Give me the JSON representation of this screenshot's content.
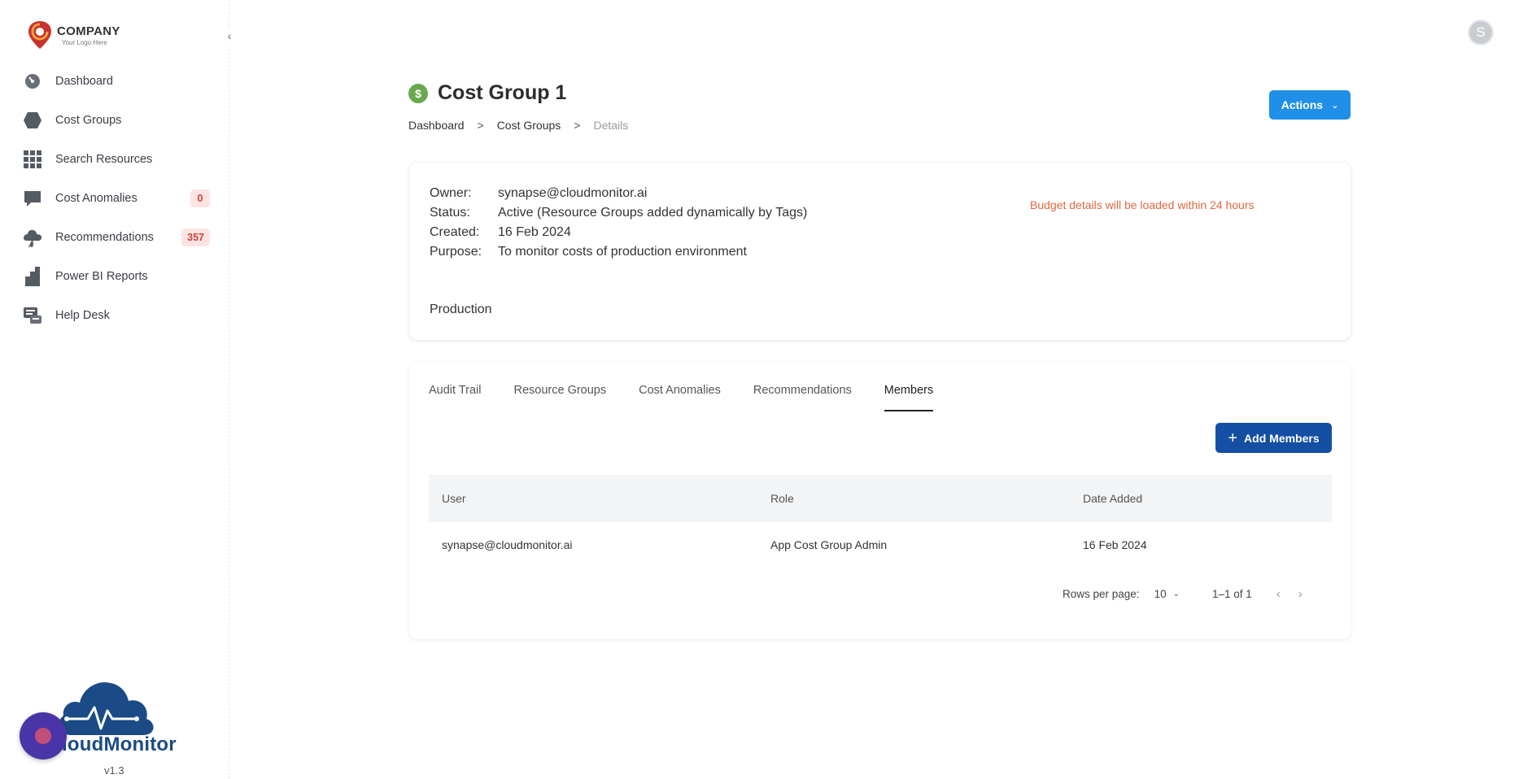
{
  "brand": {
    "company": "COMPANY",
    "tagline": "Your Logo Here",
    "product": "loudMonitor",
    "version": "v1.3"
  },
  "sidebar": {
    "collapse_glyph": "‹",
    "items": [
      {
        "label": "Dashboard",
        "icon": "gauge-icon"
      },
      {
        "label": "Cost Groups",
        "icon": "hexagon-icon"
      },
      {
        "label": "Search Resources",
        "icon": "grid-icon"
      },
      {
        "label": "Cost Anomalies",
        "icon": "chat-bubble-icon",
        "badge": "0"
      },
      {
        "label": "Recommendations",
        "icon": "cloud-icon",
        "badge": "357"
      },
      {
        "label": "Power BI Reports",
        "icon": "bar-chart-icon"
      },
      {
        "label": "Help Desk",
        "icon": "help-desk-icon"
      }
    ]
  },
  "user": {
    "avatar_letter": "S"
  },
  "header": {
    "title_icon": "$",
    "title": "Cost Group 1",
    "breadcrumb": [
      "Dashboard",
      ">",
      "Cost Groups",
      ">",
      "Details"
    ],
    "actions_label": "Actions"
  },
  "details": {
    "rows": [
      {
        "key": "Owner:",
        "value": "synapse@cloudmonitor.ai"
      },
      {
        "key": "Status:",
        "value": "Active (Resource Groups added dynamically by Tags)"
      },
      {
        "key": "Created:",
        "value": "16 Feb 2024"
      },
      {
        "key": "Purpose:",
        "value": "To monitor costs of production environment"
      }
    ],
    "budget_note": "Budget details will be loaded within 24 hours",
    "tag": "Production"
  },
  "tabs": [
    "Audit Trail",
    "Resource Groups",
    "Cost Anomalies",
    "Recommendations",
    "Members"
  ],
  "active_tab": "Members",
  "members": {
    "add_label": "Add Members",
    "columns": [
      "User",
      "Role",
      "Date Added"
    ],
    "rows": [
      {
        "user": "synapse@cloudmonitor.ai",
        "role": "App Cost Group Admin",
        "date": "16 Feb 2024"
      }
    ],
    "pagination": {
      "rows_per_page_label": "Rows per page:",
      "rows_per_page": "10",
      "range": "1–1 of 1"
    }
  },
  "colors": {
    "primary": "#1f8fe8",
    "primary_dark": "#144fa3",
    "warning_text": "#e0683f",
    "badge_bg": "#fde3e1",
    "badge_text": "#c9453d"
  }
}
